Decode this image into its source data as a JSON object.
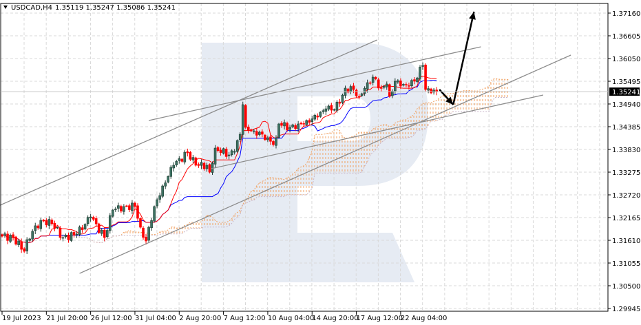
{
  "header": {
    "symbol": "USDCAD,H4",
    "ohlc": "1.35119 1.35247 1.35086 1.35241"
  },
  "colors": {
    "bull": "#3d7262",
    "bull_outline": "#1c3a30",
    "bear": "#ff0000",
    "tenkan": "#ff0000",
    "kijun": "#0000ff",
    "cloud_up": "#f0a060",
    "cloud_down": "#c8b4c8",
    "trendline": "#8c8c8c",
    "arrow": "#000000",
    "grid": "#d9d9d9",
    "watermark": "#e6ebf3"
  },
  "chart_data": {
    "type": "candlestick",
    "title": "USDCAD,H4",
    "ylim": [
      1.29945,
      1.3716
    ],
    "yticks": [
      "1.37160",
      "1.36605",
      "1.36050",
      "1.35495",
      "1.34940",
      "1.34385",
      "1.33830",
      "1.33275",
      "1.32720",
      "1.32165",
      "1.31610",
      "1.31055",
      "1.30500",
      "1.29945"
    ],
    "xticks": [
      {
        "bar": 0,
        "label": "19 Jul 2023"
      },
      {
        "bar": 16,
        "label": "21 Jul 20:00"
      },
      {
        "bar": 32,
        "label": "26 Jul 12:00"
      },
      {
        "bar": 48,
        "label": "31 Jul 04:00"
      },
      {
        "bar": 64,
        "label": "2 Aug 20:00"
      },
      {
        "bar": 80,
        "label": "7 Aug 12:00"
      },
      {
        "bar": 96,
        "label": "10 Aug 04:00"
      },
      {
        "bar": 112,
        "label": "14 Aug 20:00"
      },
      {
        "bar": 128,
        "label": "17 Aug 12:00"
      },
      {
        "bar": 144,
        "label": "22 Aug 04:00"
      }
    ],
    "bar_count": 158,
    "current_price": "1.35241",
    "close_path": [
      [
        0,
        1.3171
      ],
      [
        4,
        1.31677
      ],
      [
        8,
        1.3134
      ],
      [
        9,
        1.31626
      ],
      [
        14,
        1.32097
      ],
      [
        18,
        1.32013
      ],
      [
        22,
        1.31677
      ],
      [
        27,
        1.31761
      ],
      [
        32,
        1.32181
      ],
      [
        37,
        1.31677
      ],
      [
        40,
        1.3235
      ],
      [
        44,
        1.32434
      ],
      [
        48,
        1.32434
      ],
      [
        50,
        1.31929
      ],
      [
        52,
        1.31593
      ],
      [
        53,
        1.31929
      ],
      [
        55,
        1.32434
      ],
      [
        58,
        1.32938
      ],
      [
        62,
        1.33443
      ],
      [
        67,
        1.33746
      ],
      [
        70,
        1.33443
      ],
      [
        74,
        1.33443
      ],
      [
        75,
        1.33275
      ],
      [
        77,
        1.33863
      ],
      [
        82,
        1.33695
      ],
      [
        84,
        1.33779
      ],
      [
        86,
        1.342
      ],
      [
        87,
        1.34923
      ],
      [
        88,
        1.34368
      ],
      [
        91,
        1.34284
      ],
      [
        94,
        1.342
      ],
      [
        96,
        1.34116
      ],
      [
        98,
        1.33947
      ],
      [
        99,
        1.34116
      ],
      [
        100,
        1.34452
      ],
      [
        104,
        1.34368
      ],
      [
        107,
        1.34452
      ],
      [
        110,
        1.34536
      ],
      [
        114,
        1.3462
      ],
      [
        117,
        1.34822
      ],
      [
        119,
        1.34788
      ],
      [
        122,
        1.34957
      ],
      [
        124,
        1.35327
      ],
      [
        127,
        1.35293
      ],
      [
        129,
        1.35125
      ],
      [
        132,
        1.35461
      ],
      [
        134,
        1.35596
      ],
      [
        137,
        1.35327
      ],
      [
        139,
        1.35428
      ],
      [
        140,
        1.35125
      ],
      [
        142,
        1.35495
      ],
      [
        144,
        1.35377
      ],
      [
        147,
        1.35377
      ],
      [
        149,
        1.35495
      ],
      [
        152,
        1.35882
      ],
      [
        153,
        1.35293
      ],
      [
        155,
        1.35209
      ],
      [
        157,
        1.35241
      ]
    ],
    "indicators": {
      "type": "ichimoku",
      "tenkan": 9,
      "kijun": 26,
      "senkou_b": 52,
      "shift": 26
    },
    "trendlines": [
      {
        "from": [
          -0.75,
          1.32467
        ],
        "to": [
          135.5,
          1.36504
        ]
      },
      {
        "from": [
          53,
          1.34536
        ],
        "to": [
          173,
          1.36336
        ]
      },
      {
        "from": [
          28,
          1.30802
        ],
        "to": [
          205.5,
          1.36134
        ]
      },
      {
        "from": [
          75.5,
          1.33359
        ],
        "to": [
          195.5,
          1.35159
        ]
      }
    ],
    "arrows": [
      {
        "from": [
          158,
          1.35293
        ],
        "to": [
          163,
          1.34923
        ]
      },
      {
        "from": [
          163,
          1.34923
        ],
        "to": [
          170.5,
          1.37194
        ]
      }
    ]
  }
}
